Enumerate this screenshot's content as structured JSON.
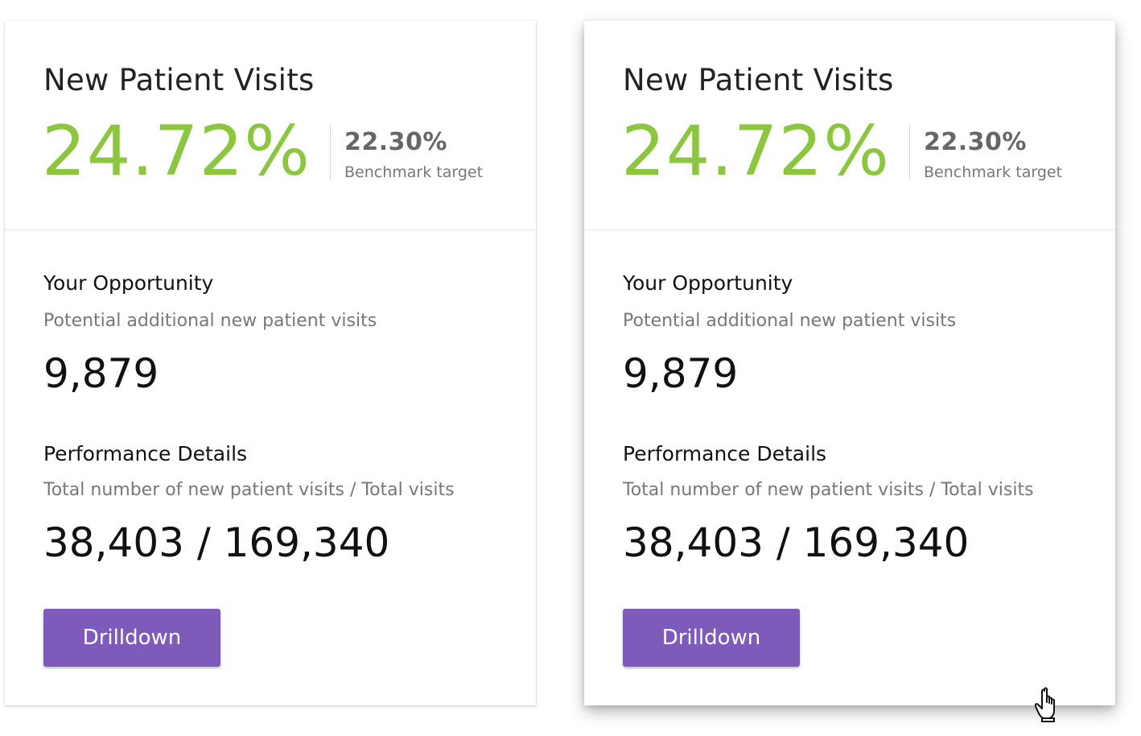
{
  "cards": [
    {
      "state": "default",
      "title": "New Patient Visits",
      "value": "24.72%",
      "benchmark_value": "22.30%",
      "benchmark_label": "Benchmark target",
      "opportunity_title": "Your Opportunity",
      "opportunity_sub": "Potential additional new patient visits",
      "opportunity_value": "9,879",
      "performance_title": "Performance Details",
      "performance_sub": "Total number of new patient visits / Total visits",
      "performance_value": "38,403 / 169,340",
      "button_label": "Drilldown"
    },
    {
      "state": "hover",
      "title": "New Patient Visits",
      "value": "24.72%",
      "benchmark_value": "22.30%",
      "benchmark_label": "Benchmark target",
      "opportunity_title": "Your Opportunity",
      "opportunity_sub": "Potential additional new patient visits",
      "opportunity_value": "9,879",
      "performance_title": "Performance Details",
      "performance_sub": "Total number of new patient visits / Total visits",
      "performance_value": "38,403 / 169,340",
      "button_label": "Drilldown"
    }
  ],
  "colors": {
    "metric_value": "#8cc63f",
    "button_bg": "#7e5bbb",
    "button_text": "#ffffff",
    "title_text": "#222222",
    "sub_text": "#777777",
    "benchmark_text": "#666666"
  },
  "icons": {
    "cursor": "hand-pointer-icon"
  }
}
